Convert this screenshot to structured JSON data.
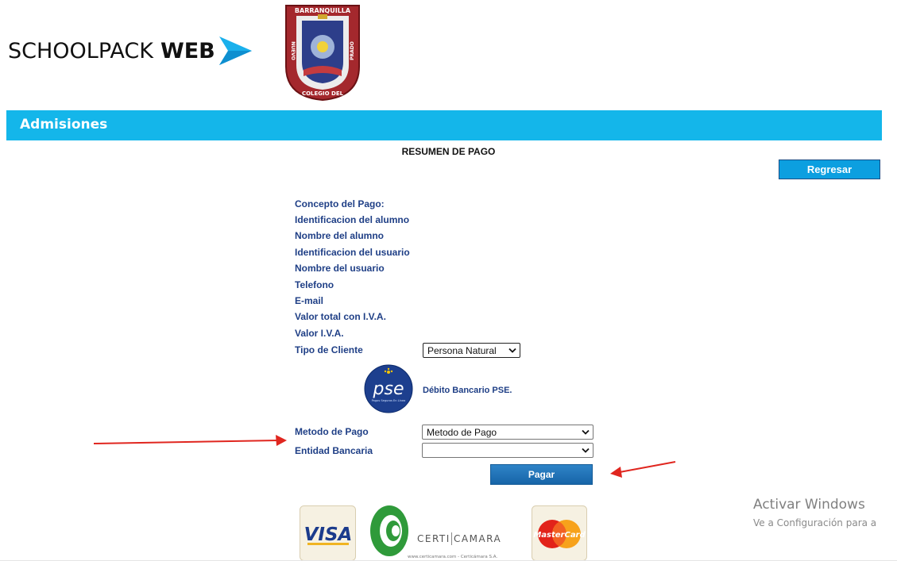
{
  "brand": {
    "light": "SCHOOLPACK",
    "bold": "WEB"
  },
  "crest": {
    "top_text": "BARRANQUILLA",
    "bottom_text": "COLEGIO DEL",
    "left_text": "NUEVO",
    "right_text": "PRADO"
  },
  "header": {
    "title": "Admisiones"
  },
  "summary": {
    "title": "RESUMEN DE PAGO"
  },
  "back_button": {
    "label": "Regresar"
  },
  "fields": [
    "Concepto del Pago:",
    "Identificacion del alumno",
    "Nombre del alumno",
    "Identificacion del usuario",
    "Nombre del usuario",
    "Telefono",
    "E-mail",
    "Valor total con I.V.A.",
    "Valor I.V.A."
  ],
  "client_type": {
    "label": "Tipo de Cliente",
    "value": "Persona Natural"
  },
  "pse": {
    "logo_text": "pse",
    "logo_subtext": "Pagos Seguros En Línea",
    "label": "Débito Bancario PSE."
  },
  "payment_method": {
    "label": "Metodo de Pago",
    "value": "Metodo de Pago"
  },
  "bank": {
    "label": "Entidad Bancaria",
    "value": ""
  },
  "pay_button": {
    "label": "Pagar"
  },
  "logos": {
    "visa": "VISA",
    "certicamara_brand_a": "CERTI",
    "certicamara_brand_b": "CAMARA",
    "certicamara_url": "www.certicamara.com - Certicámara S.A.",
    "mastercard": "MasterCard"
  },
  "watermark": {
    "line1": "Activar Windows",
    "line2": "Ve a Configuración para a"
  },
  "colors": {
    "accent": "#14b6ea",
    "label_blue": "#1f3f86",
    "pay_button": "#1f6fb5",
    "arrow": "#e0261f"
  }
}
